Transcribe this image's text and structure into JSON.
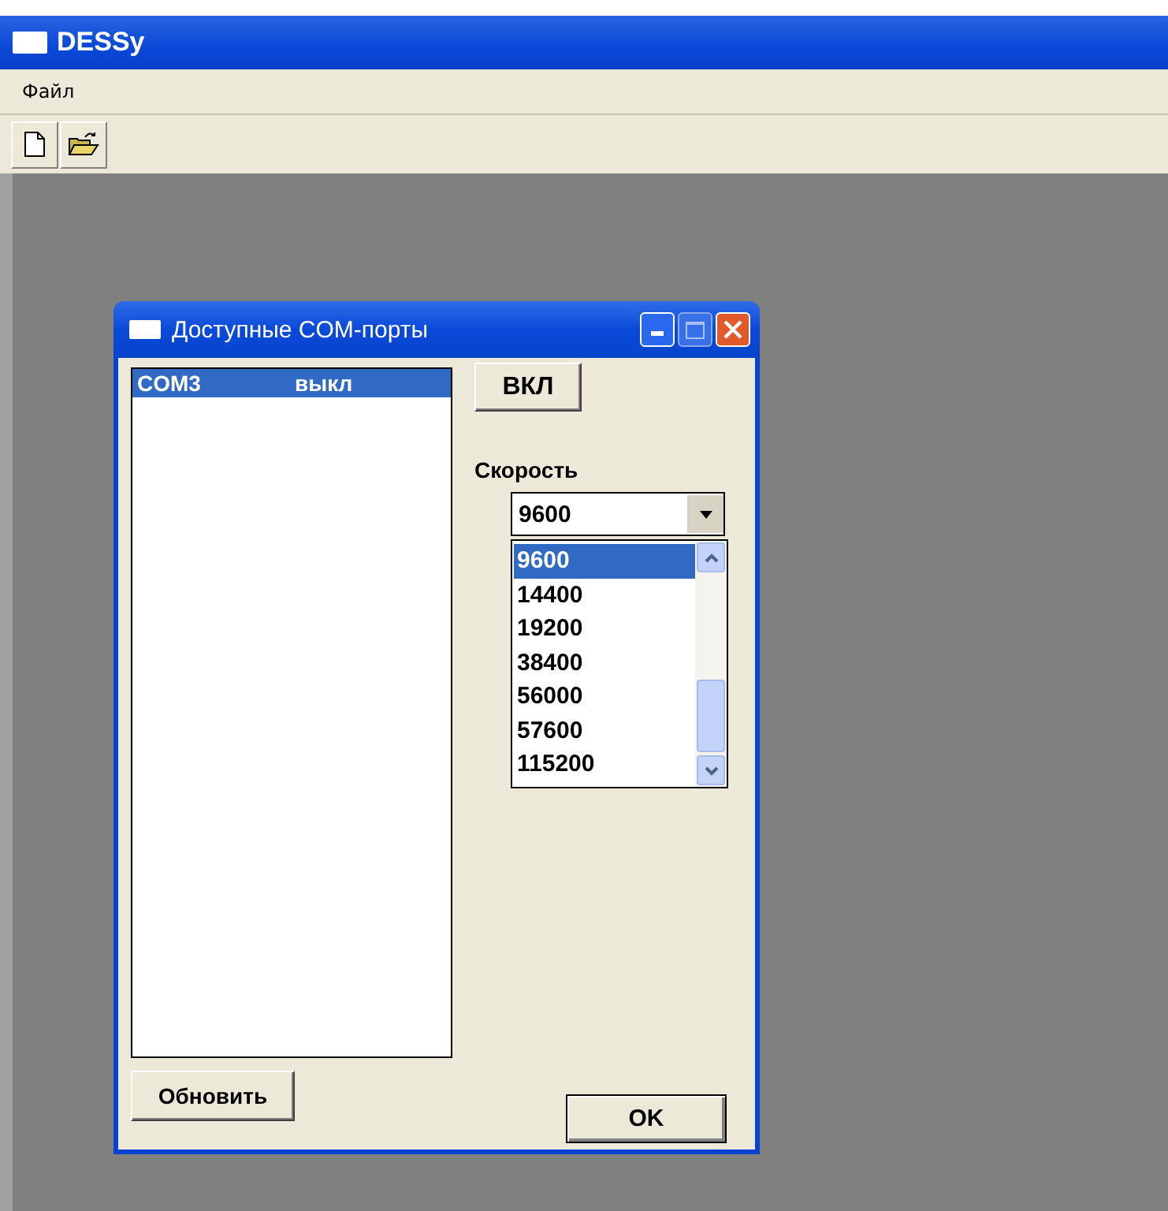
{
  "window": {
    "title": "DESSy"
  },
  "menu": [
    {
      "label": "Файл"
    }
  ],
  "toolbar": [
    {
      "kind": "new"
    },
    {
      "kind": "open"
    }
  ],
  "dialog": {
    "title": "Доступные COM-порты",
    "ports": [
      {
        "name": "COM3",
        "status": "выкл",
        "selected": true
      }
    ],
    "toggle_button": "ВКЛ",
    "speed_label": "Скорость",
    "speed_combo": {
      "value": "9600",
      "expanded": true,
      "options": [
        {
          "label": "9600",
          "selected": true
        },
        {
          "label": "14400",
          "selected": false
        },
        {
          "label": "19200",
          "selected": false
        },
        {
          "label": "38400",
          "selected": false
        },
        {
          "label": "56000",
          "selected": false
        },
        {
          "label": "57600",
          "selected": false
        },
        {
          "label": "115200",
          "selected": false
        }
      ]
    },
    "refresh_button": "Обновить",
    "ok_button": "OK"
  }
}
